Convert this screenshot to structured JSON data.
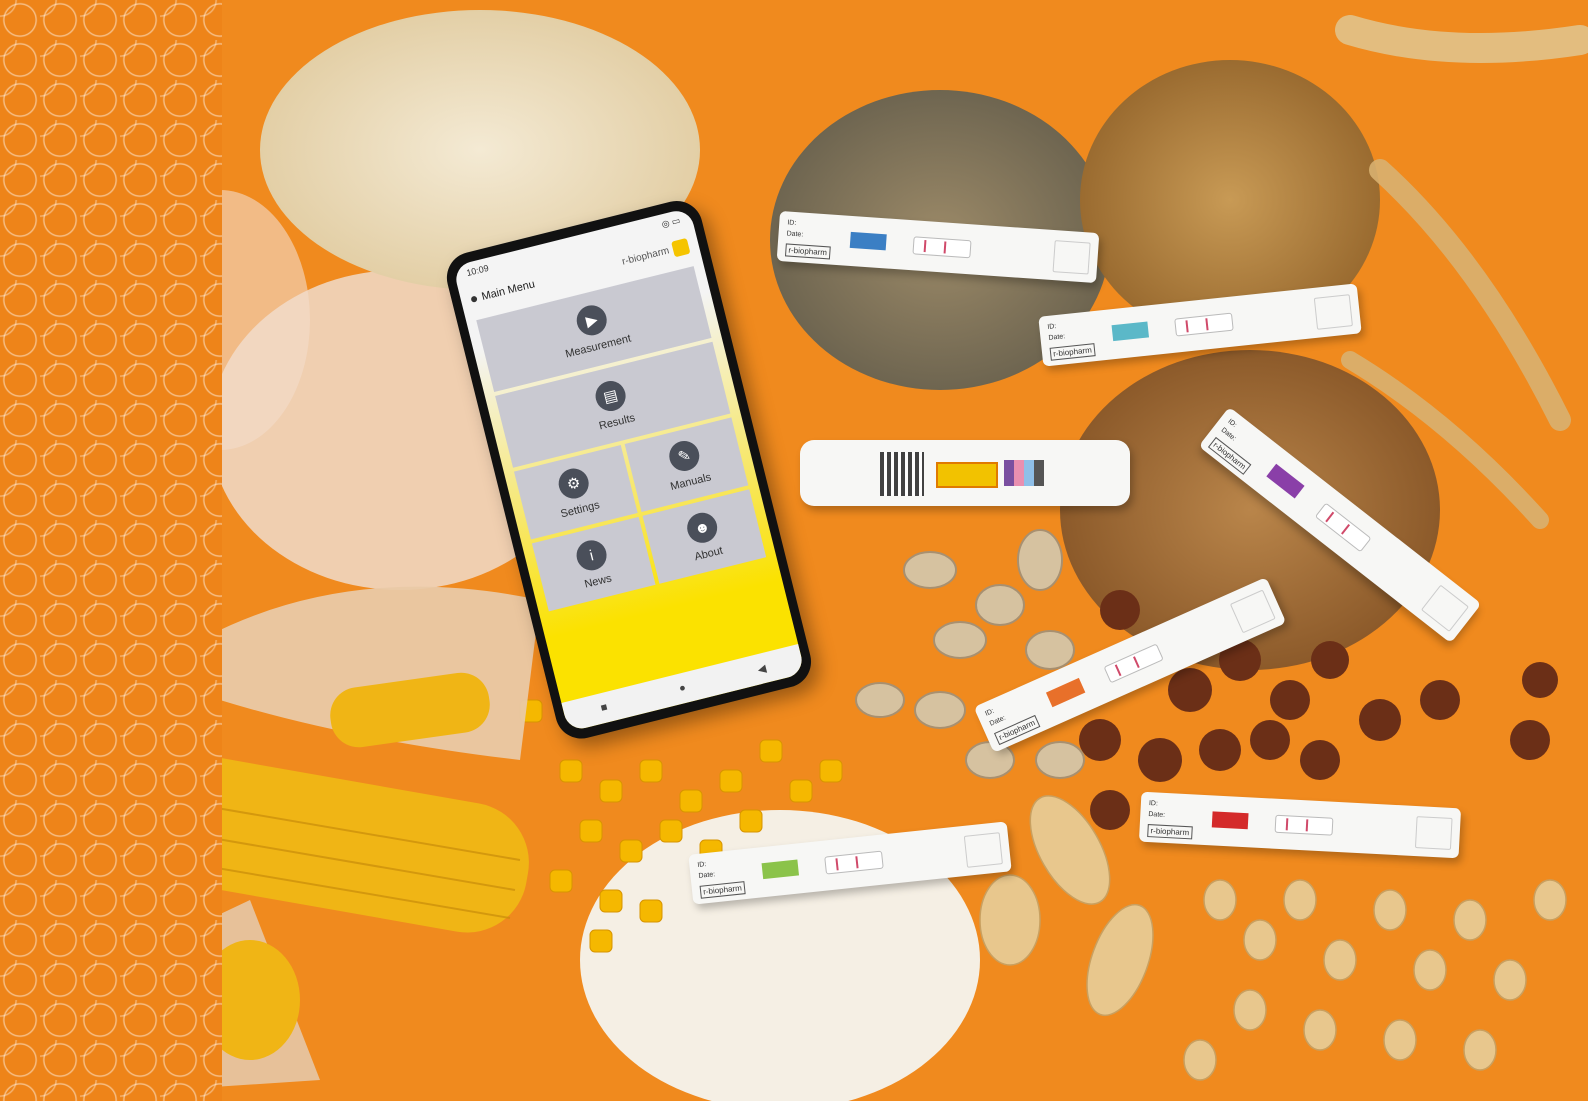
{
  "phone": {
    "status_time": "10:09",
    "status_icons": "◎ ▭",
    "app_title": "Main Menu",
    "brand": "r-biopharm",
    "menu": {
      "measurement": "Measurement",
      "results": "Results",
      "settings": "Settings",
      "manuals": "Manuals",
      "news": "News",
      "about": "About"
    },
    "nav": {
      "recents": "■",
      "home": "●",
      "back": "◀"
    }
  },
  "strip": {
    "id_label": "ID:",
    "date_label": "Date:",
    "brand": "r-biopharm",
    "test_line": "Test line",
    "control_line": "Control line",
    "sample": "Sample"
  },
  "colors": {
    "background": "#f08a1e",
    "phone_accent": "#fbe200",
    "tile": "#c9c9d1",
    "code_blue": "#3b7fc4",
    "code_teal": "#5bb8c8",
    "code_purple": "#8a3fa8",
    "code_orange": "#e8702a",
    "code_red": "#d42a2a",
    "code_green": "#8bc34a"
  },
  "icons": {
    "measurement": "play-icon",
    "results": "document-icon",
    "settings": "gear-icon",
    "manuals": "wrench-icon",
    "news": "info-icon",
    "about": "people-icon"
  }
}
